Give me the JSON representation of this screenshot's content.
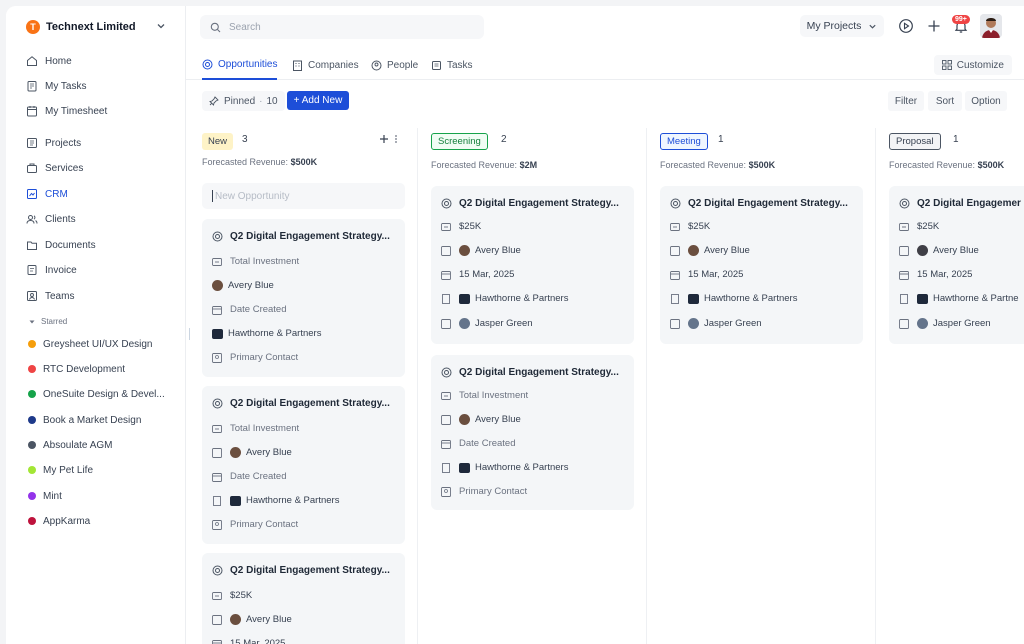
{
  "org": {
    "initial": "T",
    "name": "Technext Limited"
  },
  "nav": [
    {
      "label": "Home",
      "icon": "home-icon"
    },
    {
      "label": "My Tasks",
      "icon": "clipboard-icon"
    },
    {
      "label": "My Timesheet",
      "icon": "timesheet-icon"
    },
    {
      "label": "Projects",
      "icon": "projects-icon"
    },
    {
      "label": "Services",
      "icon": "services-icon"
    },
    {
      "label": "CRM",
      "icon": "crm-icon",
      "active": true
    },
    {
      "label": "Clients",
      "icon": "clients-icon"
    },
    {
      "label": "Documents",
      "icon": "documents-icon"
    },
    {
      "label": "Invoice",
      "icon": "invoice-icon"
    },
    {
      "label": "Teams",
      "icon": "teams-icon"
    }
  ],
  "starred": {
    "heading": "Starred",
    "items": [
      {
        "label": "Greysheet UI/UX Design",
        "color": "#f59e0b"
      },
      {
        "label": "RTC Development",
        "color": "#ef4444"
      },
      {
        "label": "OneSuite Design & Devel...",
        "color": "#16a34a"
      },
      {
        "label": "Book a Market Design",
        "color": "#1e3a8a"
      },
      {
        "label": "Absoulate AGM",
        "color": "#4b5563"
      },
      {
        "label": "My Pet Life",
        "color": "#a3e635"
      },
      {
        "label": "Mint",
        "color": "#9333ea"
      },
      {
        "label": "AppKarma",
        "color": "#be123c"
      }
    ]
  },
  "search": {
    "placeholder": "Search"
  },
  "topbar": {
    "projects": "My Projects",
    "notifications": "99+"
  },
  "tabs": [
    {
      "label": "Opportunities",
      "active": true
    },
    {
      "label": "Companies"
    },
    {
      "label": "People"
    },
    {
      "label": "Tasks"
    }
  ],
  "customize": "Customize",
  "toolbar": {
    "pinned": "Pinned",
    "pinned_count": "10",
    "add_new": "+ Add New",
    "filter": "Filter",
    "sort": "Sort",
    "option": "Option"
  },
  "new_opportunity_placeholder": "New Opportunity",
  "columns": [
    {
      "stage": "New",
      "count": "3",
      "rev_label": "Forecasted Revenue:",
      "rev": "$500K",
      "color": "#fef3c7",
      "border": "#fef3c7",
      "text": "#374151"
    },
    {
      "stage": "Screening",
      "count": "2",
      "rev_label": "Forecasted Revenue:",
      "rev": "$2M",
      "color": "#f0fdf4",
      "border": "#16a34a",
      "text": "#15803d"
    },
    {
      "stage": "Meeting",
      "count": "1",
      "rev_label": "Forecasted Revenue:",
      "rev": "$500K",
      "color": "#eff6ff",
      "border": "#1d4ed8",
      "text": "#1d4ed8"
    },
    {
      "stage": "Proposal",
      "count": "1",
      "rev_label": "Forecasted Revenue:",
      "rev": "$500K",
      "color": "#f3f4f6",
      "border": "#4b5563",
      "text": "#374151"
    }
  ],
  "cards": {
    "title": "Q2 Digital Engagement Strategy...",
    "empty": {
      "investment": "Total Investment",
      "person": "Avery Blue",
      "date": "Date Created",
      "company": "Hawthorne & Partners",
      "contact": "Primary Contact"
    },
    "filled": {
      "investment": "$25K",
      "person": "Avery Blue",
      "date": "15 Mar, 2025",
      "company": "Hawthorne & Partners",
      "contact": "Jasper Green"
    },
    "proposal_company": "Hawthorne & Partne",
    "proposal_title": "Q2 Digital Engagemer"
  }
}
